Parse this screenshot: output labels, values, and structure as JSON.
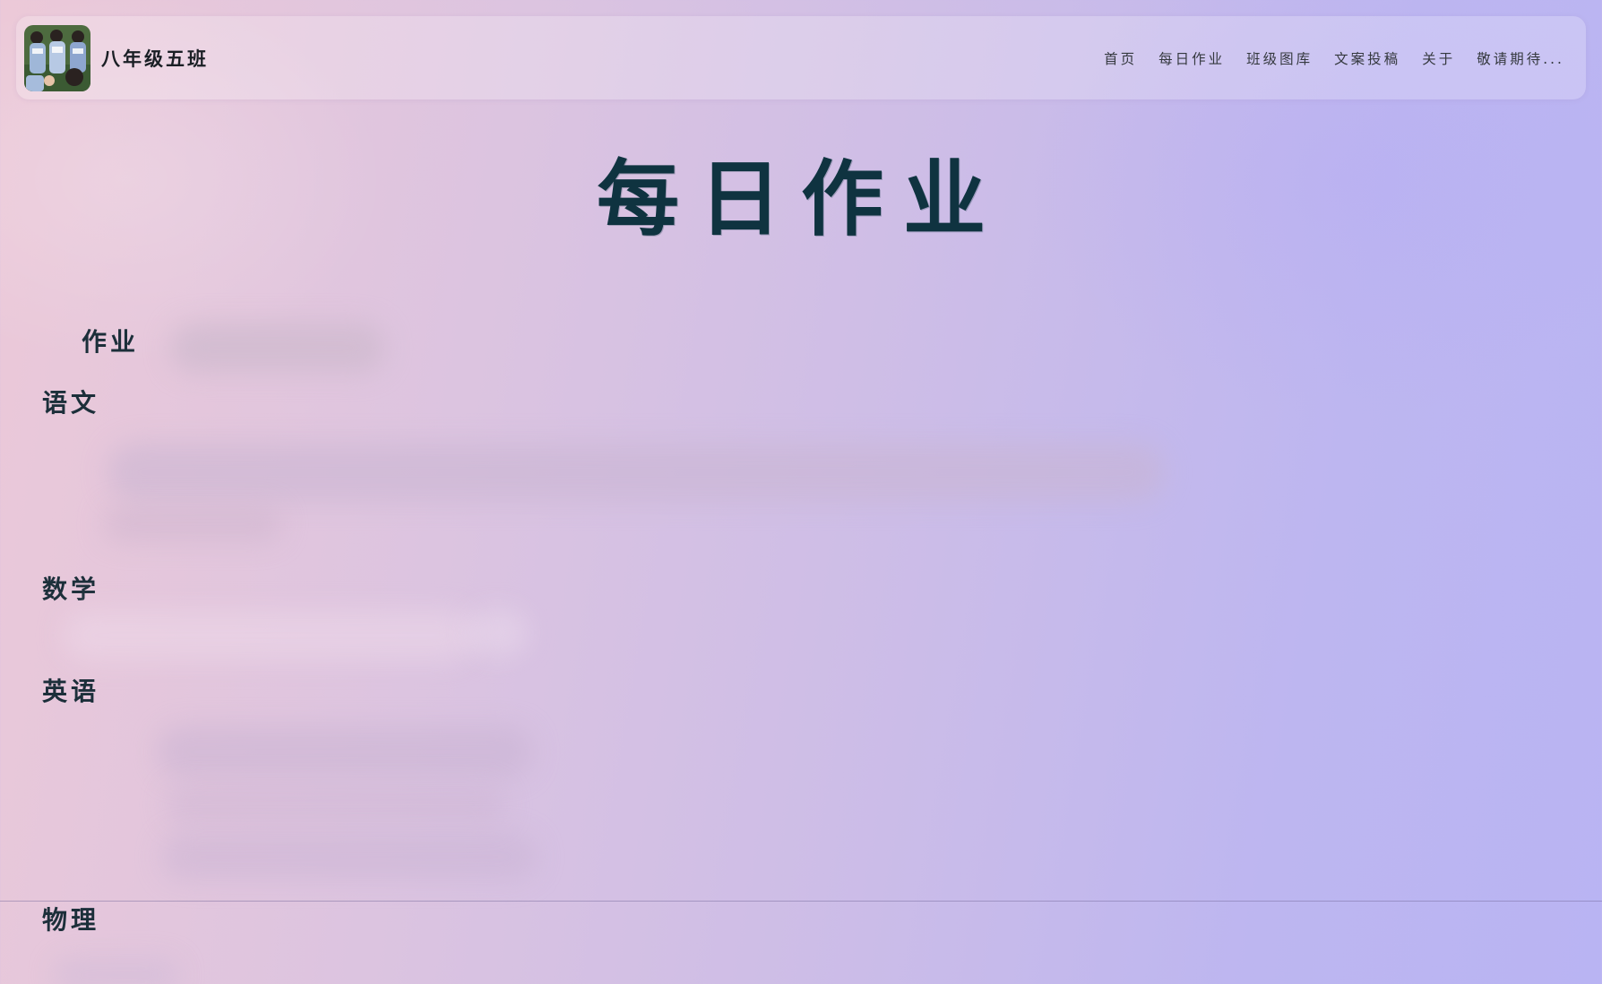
{
  "header": {
    "brand": "八年级五班",
    "logo_icon": "class-photo-logo",
    "nav": [
      {
        "label": "首页"
      },
      {
        "label": "每日作业"
      },
      {
        "label": "班级图库"
      },
      {
        "label": "文案投稿"
      },
      {
        "label": "关于"
      },
      {
        "label": "敬请期待..."
      }
    ]
  },
  "main": {
    "title": "每日作业",
    "section_heading": "作业",
    "subjects": [
      {
        "label": "语文"
      },
      {
        "label": "数学"
      },
      {
        "label": "英语"
      },
      {
        "label": "物理"
      }
    ]
  },
  "colors": {
    "title": "#0f3340",
    "text": "#1c2f3a",
    "bg_start": "#ecc9d8",
    "bg_end": "#b9b4f3"
  }
}
